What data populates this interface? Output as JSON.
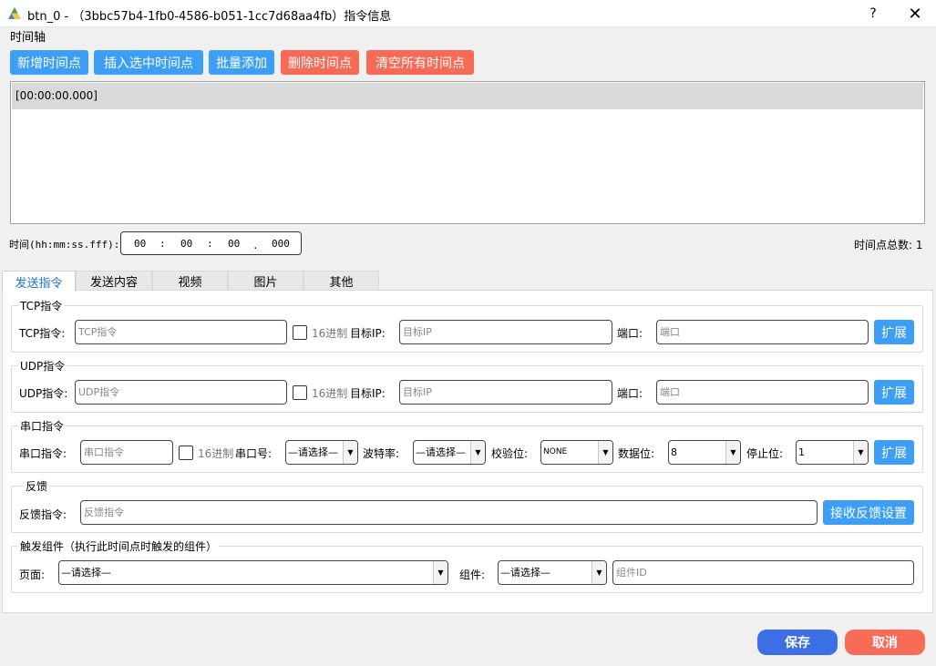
{
  "window": {
    "title": "btn_0 -  （3bbc57b4-1fb0-4586-b051-1cc7d68aa4fb）指令信息",
    "help_label": "?",
    "close_label": "✕"
  },
  "timeline": {
    "section_label": "时间轴",
    "buttons": {
      "add": "新增时间点",
      "insert_selected": "插入选中时间点",
      "batch_add": "批量添加",
      "delete": "删除时间点",
      "clear_all": "清空所有时间点"
    },
    "items": [
      "[00:00:00.000]"
    ],
    "time_label": "时间(hh:mm:ss.fff):",
    "time": {
      "hh": "00",
      "mm": "00",
      "ss": "00",
      "fff": "000",
      "sep1": ":",
      "sep2": ":",
      "sep3": "."
    },
    "total_label": "时间点总数: 1"
  },
  "tabs": [
    "发送指令",
    "发送内容",
    "视频",
    "图片",
    "其他"
  ],
  "tcp": {
    "group_title": "TCP指令",
    "label": "TCP指令:",
    "placeholder": "TCP指令",
    "hex_label": "16进制",
    "ip_label": "目标IP:",
    "ip_placeholder": "目标IP",
    "port_label": "端口:",
    "port_placeholder": "端口",
    "expand_label": "扩展"
  },
  "udp": {
    "group_title": "UDP指令",
    "label": "UDP指令:",
    "placeholder": "UDP指令",
    "hex_label": "16进制",
    "ip_label": "目标IP:",
    "ip_placeholder": "目标IP",
    "port_label": "端口:",
    "port_placeholder": "端口",
    "expand_label": "扩展"
  },
  "serial": {
    "group_title": "串口指令",
    "label": "串口指令:",
    "placeholder": "串口指令",
    "hex_label": "16进制",
    "port_label": "串口号:",
    "port_value": "—请选择—",
    "baud_label": "波特率:",
    "baud_value": "—请选择—",
    "parity_label": "校验位:",
    "parity_value": "NONE",
    "databits_label": "数据位:",
    "databits_value": "8",
    "stopbits_label": "停止位:",
    "stopbits_value": "1",
    "expand_label": "扩展"
  },
  "feedback": {
    "group_title": "反馈",
    "label": "反馈指令:",
    "placeholder": "反馈指令",
    "settings_label": "接收反馈设置"
  },
  "trigger": {
    "group_title": "触发组件（执行此时间点时触发的组件）",
    "page_label": "页面:",
    "page_value": "—请选择—",
    "component_label": "组件:",
    "component_value": "—请选择—",
    "component_id_placeholder": "组件ID"
  },
  "footer": {
    "save_label": "保存",
    "cancel_label": "取消"
  },
  "colors": {
    "blue": "#3c9ef5",
    "red": "#f66a56",
    "save": "#3c6ee6",
    "cancel": "#f76b57"
  }
}
